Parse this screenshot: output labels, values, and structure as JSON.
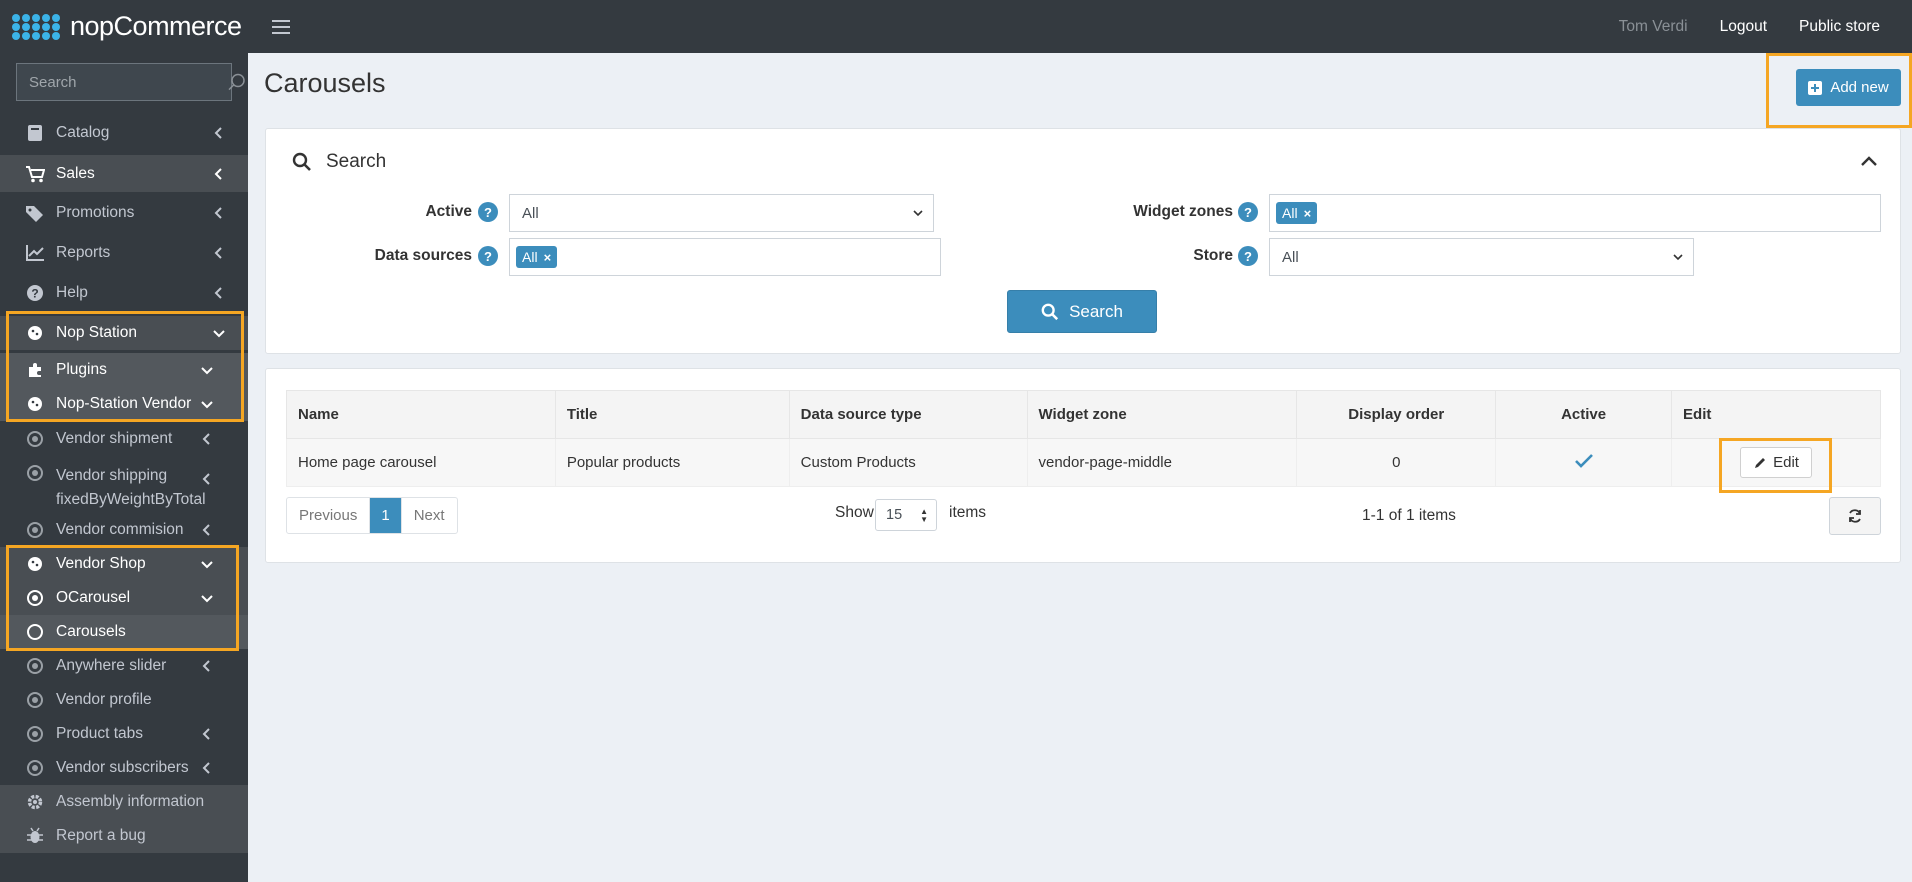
{
  "brand": {
    "name": "nopCommerce"
  },
  "sidebar": {
    "search_placeholder": "Search",
    "items": [
      {
        "label": "Catalog",
        "icon": "book-icon"
      },
      {
        "label": "Sales",
        "icon": "cart-icon"
      },
      {
        "label": "Promotions",
        "icon": "tags-icon"
      },
      {
        "label": "Reports",
        "icon": "chart-line-icon"
      },
      {
        "label": "Help",
        "icon": "question-circle-icon"
      },
      {
        "label": "Nop Station",
        "icon": "cookie-icon"
      },
      {
        "label": "Plugins",
        "icon": "puzzle-icon"
      },
      {
        "label": "Nop-Station Vendor",
        "icon": "cookie-icon"
      },
      {
        "label": "Vendor shipment",
        "icon": "dot-circle-icon"
      },
      {
        "label": "Vendor shipping",
        "label2": "fixedByWeightByTotal",
        "icon": "dot-circle-icon"
      },
      {
        "label": "Vendor commision",
        "icon": "dot-circle-icon"
      },
      {
        "label": "Vendor Shop",
        "icon": "cookie-icon"
      },
      {
        "label": "OCarousel",
        "icon": "dot-circle-icon"
      },
      {
        "label": "Carousels",
        "icon": "circle-icon"
      },
      {
        "label": "Anywhere slider",
        "icon": "dot-circle-icon"
      },
      {
        "label": "Vendor profile",
        "icon": "dot-circle-icon"
      },
      {
        "label": "Product tabs",
        "icon": "dot-circle-icon"
      },
      {
        "label": "Vendor subscribers",
        "icon": "dot-circle-icon"
      },
      {
        "label": "Assembly information",
        "icon": "gear-icon"
      },
      {
        "label": "Report a bug",
        "icon": "bug-icon"
      }
    ]
  },
  "topbar": {
    "user": "Tom Verdi",
    "logout": "Logout",
    "public_store": "Public store"
  },
  "page": {
    "title": "Carousels",
    "add_new": "Add new"
  },
  "search": {
    "header": "Search",
    "active_label": "Active",
    "active_value": "All",
    "data_sources_label": "Data sources",
    "data_sources_tag": "All",
    "widget_zones_label": "Widget zones",
    "widget_zones_tag": "All",
    "store_label": "Store",
    "store_value": "All",
    "button": "Search"
  },
  "grid": {
    "columns": [
      "Name",
      "Title",
      "Data source type",
      "Widget zone",
      "Display order",
      "Active",
      "Edit"
    ],
    "rows": [
      {
        "name": "Home page carousel",
        "title": "Popular products",
        "data_source_type": "Custom Products",
        "widget_zone": "vendor-page-middle",
        "display_order": "0",
        "active": true,
        "edit": "Edit"
      }
    ],
    "pager": {
      "previous": "Previous",
      "current": "1",
      "next": "Next",
      "show": "Show",
      "page_size": "15",
      "items": "items",
      "range": "1-1 of 1 items"
    }
  },
  "colors": {
    "accent": "#3c8dbc",
    "highlight": "#f5a623",
    "sidebar_bg": "#343a40",
    "active_check": "#3c8dbc"
  }
}
